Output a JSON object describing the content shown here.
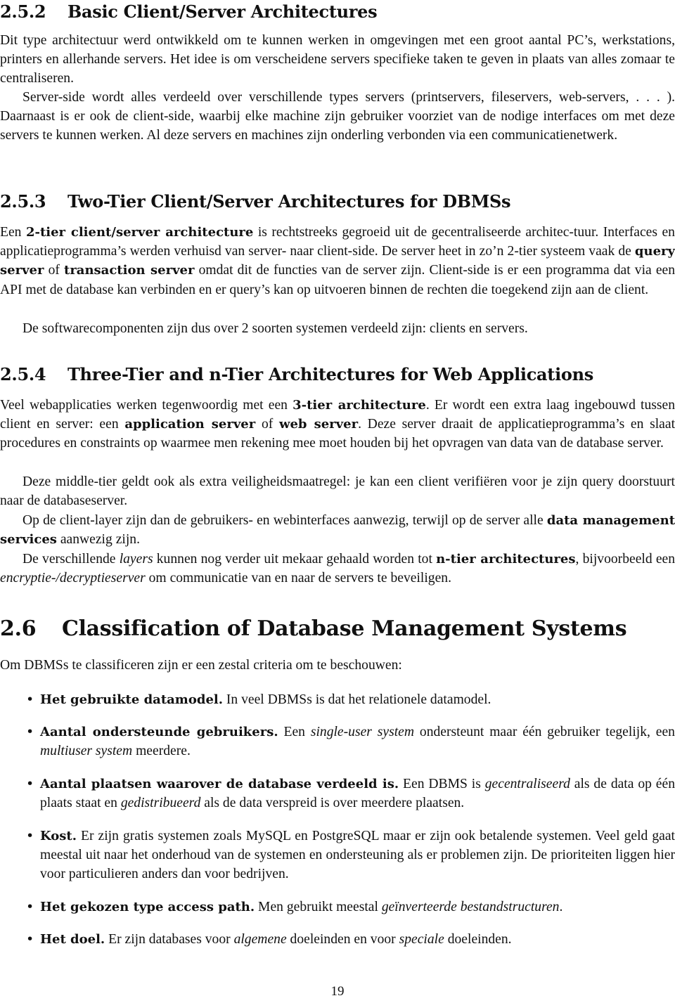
{
  "sections": {
    "s252": {
      "number": "2.5.2",
      "title": "Basic Client/Server Architectures",
      "paragraphs": [
        [
          {
            "t": "Dit type architectuur werd ontwikkeld om te kunnen werken in omgevingen met een groot aantal PC’s, werkstations, printers en allerhande servers. Het idee is om verscheidene servers specifieke taken te geven in plaats van alles zomaar te centraliseren.",
            "s": ""
          }
        ],
        [
          {
            "t": "Server-side wordt alles verdeeld over verschillende types servers (printservers, fileservers, web-servers, . . . ). Daarnaast is er ook de client-side, waarbij elke machine zijn gebruiker voorziet van de nodige interfaces om met deze servers te kunnen werken. Al deze servers en machines zijn onderling verbonden via een communicatienetwerk.",
            "s": ""
          }
        ]
      ]
    },
    "s253": {
      "number": "2.5.3",
      "title": "Two-Tier Client/Server Architectures for DBMSs",
      "paragraphs": [
        [
          {
            "t": "Een ",
            "s": ""
          },
          {
            "t": "2-tier client/server architecture",
            "s": "b"
          },
          {
            "t": " is rechtstreeks gegroeid uit de gecentraliseerde architec-tuur. Interfaces en applicatieprogramma’s werden verhuisd van server- naar client-side. De server heet in zo’n 2-tier systeem vaak de ",
            "s": ""
          },
          {
            "t": "query server",
            "s": "b"
          },
          {
            "t": " of ",
            "s": ""
          },
          {
            "t": "transaction server",
            "s": "b"
          },
          {
            "t": " omdat dit de functies van de server zijn. Client-side is er een programma dat via een API met de database kan verbinden en er query’s kan op uitvoeren binnen de rechten die toegekend zijn aan de client.",
            "s": ""
          }
        ],
        [
          {
            "t": "De softwarecomponenten zijn dus over 2 soorten systemen verdeeld zijn: clients en servers.",
            "s": ""
          }
        ]
      ]
    },
    "s254": {
      "number": "2.5.4",
      "title": "Three-Tier and n-Tier Architectures for Web Applications",
      "paragraphs": [
        [
          {
            "t": "Veel webapplicaties werken tegenwoordig met een ",
            "s": ""
          },
          {
            "t": "3-tier architecture",
            "s": "b"
          },
          {
            "t": ". Er wordt een extra laag ingebouwd tussen client en server: een ",
            "s": ""
          },
          {
            "t": "application server",
            "s": "b"
          },
          {
            "t": " of ",
            "s": ""
          },
          {
            "t": "web server",
            "s": "b"
          },
          {
            "t": ". Deze server draait de applicatieprogramma’s en slaat procedures en constraints op waarmee men rekening mee moet houden bij het opvragen van data van de database server.",
            "s": ""
          }
        ],
        [
          {
            "t": "Deze middle-tier geldt ook als extra veiligheidsmaatregel: je kan een client verifiëren voor je zijn query doorstuurt naar de databaseserver.",
            "s": ""
          }
        ],
        [
          {
            "t": "Op de client-layer zijn dan de gebruikers- en webinterfaces aanwezig, terwijl op de server alle ",
            "s": ""
          },
          {
            "t": "data management services",
            "s": "b"
          },
          {
            "t": " aanwezig zijn.",
            "s": ""
          }
        ],
        [
          {
            "t": "De verschillende ",
            "s": ""
          },
          {
            "t": "layers",
            "s": "i"
          },
          {
            "t": " kunnen nog verder uit mekaar gehaald worden tot ",
            "s": ""
          },
          {
            "t": "n-tier architectures",
            "s": "b"
          },
          {
            "t": ", bijvoorbeeld een ",
            "s": ""
          },
          {
            "t": "encryptie-/decryptieserver",
            "s": "i"
          },
          {
            "t": " om communicatie van en naar de servers te beveiligen.",
            "s": ""
          }
        ]
      ]
    },
    "s26": {
      "number": "2.6",
      "title": "Classification of Database Management Systems",
      "intro": "Om DBMSs te classificeren zijn er een zestal criteria om te beschouwen:",
      "criteria": [
        [
          {
            "t": "Het gebruikte datamodel.",
            "s": "b"
          },
          {
            "t": " In veel DBMSs is dat het relationele datamodel.",
            "s": ""
          }
        ],
        [
          {
            "t": "Aantal ondersteunde gebruikers.",
            "s": "b"
          },
          {
            "t": " Een ",
            "s": ""
          },
          {
            "t": "single-user system",
            "s": "i"
          },
          {
            "t": " ondersteunt maar één gebruiker tegelijk, een ",
            "s": ""
          },
          {
            "t": "multiuser system",
            "s": "i"
          },
          {
            "t": " meerdere.",
            "s": ""
          }
        ],
        [
          {
            "t": "Aantal plaatsen waarover de database verdeeld is.",
            "s": "b"
          },
          {
            "t": " Een DBMS is ",
            "s": ""
          },
          {
            "t": "gecentraliseerd",
            "s": "i"
          },
          {
            "t": " als de data op één plaats staat en ",
            "s": ""
          },
          {
            "t": "gedistribueerd",
            "s": "i"
          },
          {
            "t": " als de data verspreid is over meerdere plaatsen.",
            "s": ""
          }
        ],
        [
          {
            "t": "Kost.",
            "s": "b"
          },
          {
            "t": " Er zijn gratis systemen zoals MySQL en PostgreSQL maar er zijn ook betalende systemen. Veel geld gaat meestal uit naar het onderhoud van de systemen en ondersteuning als er problemen zijn. De prioriteiten liggen hier voor particulieren anders dan voor bedrijven.",
            "s": ""
          }
        ],
        [
          {
            "t": "Het gekozen type access path.",
            "s": "b"
          },
          {
            "t": " Men gebruikt meestal ",
            "s": ""
          },
          {
            "t": "geïnverteerde bestandstructuren",
            "s": "i"
          },
          {
            "t": ".",
            "s": ""
          }
        ],
        [
          {
            "t": "Het doel.",
            "s": "b"
          },
          {
            "t": " Er zijn databases voor ",
            "s": ""
          },
          {
            "t": "algemene",
            "s": "i"
          },
          {
            "t": " doeleinden en voor ",
            "s": ""
          },
          {
            "t": "speciale",
            "s": "i"
          },
          {
            "t": " doeleinden.",
            "s": ""
          }
        ]
      ]
    }
  },
  "bullet_glyph": "•",
  "page_number": "19"
}
